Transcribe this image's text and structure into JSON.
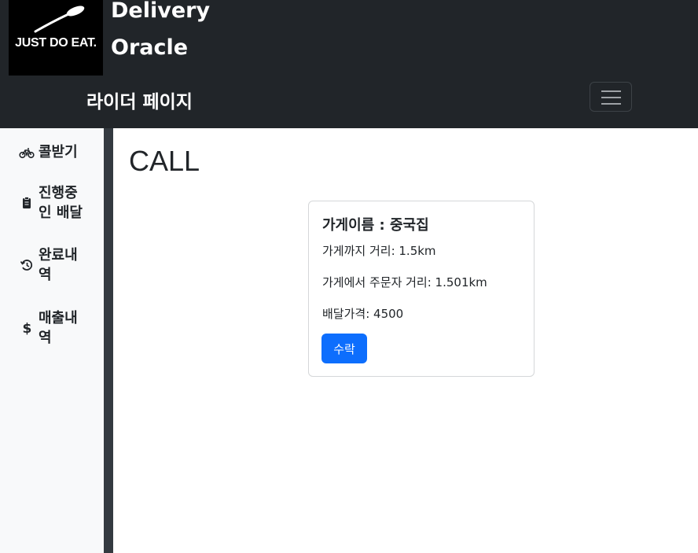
{
  "header": {
    "logo_text": "JUST DO EAT.",
    "brand_line1": "Delivery",
    "brand_line2": "Oracle",
    "page_title": "라이더 페이지",
    "menu_toggle_icon": "hamburger-icon"
  },
  "sidebar": {
    "items": [
      {
        "label": "콜받기",
        "icon": "bicycle-icon"
      },
      {
        "label": "진행중인 배달",
        "icon": "clipboard-icon"
      },
      {
        "label": "완료내역",
        "icon": "history-icon"
      },
      {
        "label": "매출내역",
        "icon": "dollar-icon"
      }
    ]
  },
  "main": {
    "title": "CALL",
    "call_card": {
      "store_name": "가게이름 : 중국집",
      "distance_to_store": "가게까지 거리: 1.5km",
      "distance_store_to_customer": "가게에서 주문자 거리: 1.501km",
      "delivery_price": "배달가격: 4500",
      "accept_label": "수락"
    }
  },
  "colors": {
    "navbar_bg": "#212529",
    "accent": "#0d6efd",
    "sidebar_bg": "#f8f9fa"
  }
}
